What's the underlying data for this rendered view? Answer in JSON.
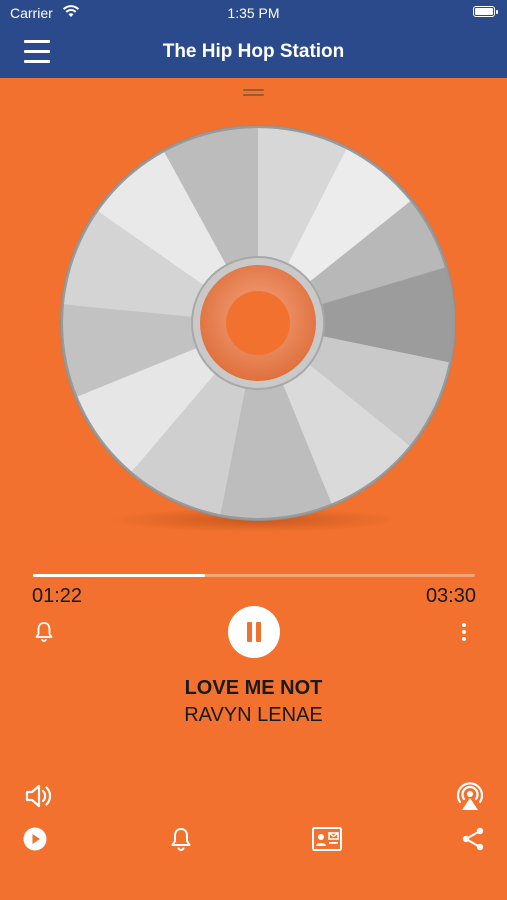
{
  "status_bar": {
    "carrier": "Carrier",
    "time": "1:35 PM"
  },
  "header": {
    "title": "The Hip Hop Station"
  },
  "player": {
    "elapsed": "01:22",
    "duration": "03:30",
    "progress": 0.39,
    "state": "playing"
  },
  "track": {
    "title": "LOVE ME NOT",
    "artist": "RAVYN LENAE"
  },
  "colors": {
    "background": "#F2712E",
    "header": "#2A4A8C",
    "progress_fill": "#FFFFFF"
  },
  "icons": {
    "top_left": "bell-icon",
    "top_center": "pause-icon",
    "top_right": "more-vertical-icon",
    "volume": "volume-icon",
    "airplay": "airplay-icon",
    "bottom": [
      "play-circle-icon",
      "bell-icon",
      "contact-card-icon",
      "share-icon"
    ]
  }
}
